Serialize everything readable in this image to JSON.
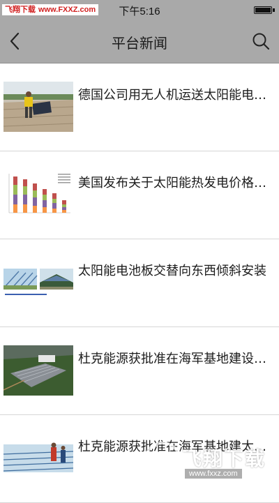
{
  "status_bar": {
    "watermark_text": "飞翔下载",
    "watermark_url": "www.FXXZ.com",
    "time": "下午5:16",
    "battery_icon": "battery-full-icon"
  },
  "nav": {
    "title": "平台新闻",
    "back_icon": "chevron-left-icon",
    "search_icon": "search-icon"
  },
  "news": [
    {
      "title": "德国公司用无人机运送太阳能电池板",
      "thumb": "worker-solar-panel-rooftop"
    },
    {
      "title": "美国发布关于太阳能热发电价格报告",
      "thumb": "stacked-bar-chart"
    },
    {
      "title": "太阳能电池板交替向东西倾斜安装",
      "thumb": "solar-panel-field"
    },
    {
      "title": "杜克能源获批准在海军基地建设太阳能",
      "thumb": "aerial-solar-farm"
    },
    {
      "title": "杜克能源获批准在海军基地建太阳能",
      "thumb": "solar-panels-workers"
    }
  ],
  "bottom_watermark": {
    "text": "飞翔下载",
    "url": "www.fxxz.com"
  }
}
